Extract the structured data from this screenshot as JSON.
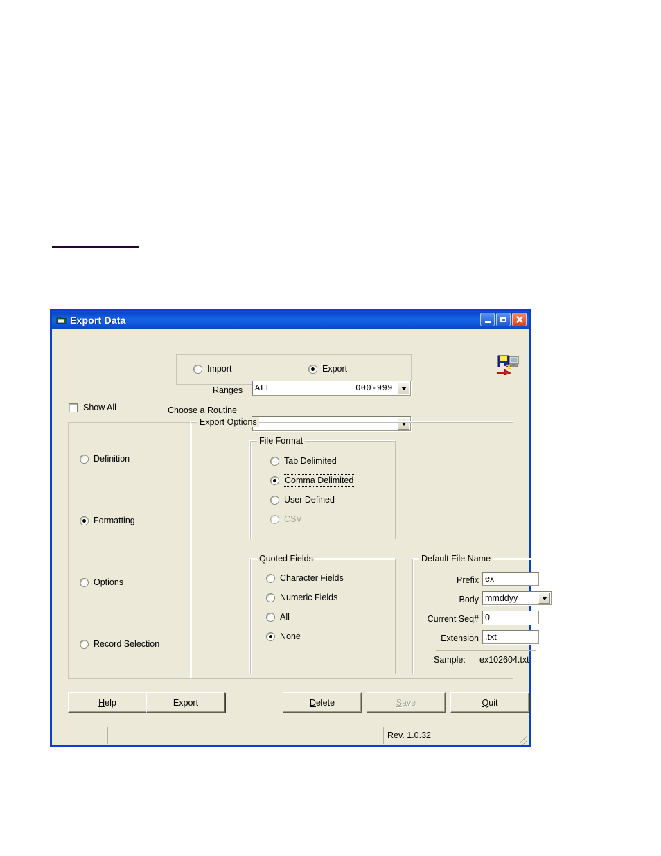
{
  "window": {
    "title": "Export Data",
    "icon": "app-window-icon",
    "buttons": {
      "minimize": "_",
      "maximize": "□",
      "close": "✕"
    }
  },
  "header_icon": "export-to-disk-icon",
  "mode": {
    "options": [
      {
        "label": "Import",
        "selected": false
      },
      {
        "label": "Export",
        "selected": true
      }
    ]
  },
  "ranges": {
    "label": "Ranges",
    "value_name": "ALL",
    "value_range": "000-999"
  },
  "routine": {
    "label": "Choose a Routine",
    "value": ""
  },
  "show_all": {
    "label": "Show All",
    "checked": false
  },
  "sections": {
    "items": [
      {
        "label": "Definition",
        "selected": false
      },
      {
        "label": "Formatting",
        "selected": true
      },
      {
        "label": "Options",
        "selected": false
      },
      {
        "label": "Record Selection",
        "selected": false
      }
    ]
  },
  "export_options": {
    "title": "Export Options",
    "file_format": {
      "title": "File Format",
      "options": [
        {
          "label": "Tab Delimited",
          "selected": false,
          "disabled": false,
          "focused": false
        },
        {
          "label": "Comma Delimited",
          "selected": true,
          "disabled": false,
          "focused": true
        },
        {
          "label": "User Defined",
          "selected": false,
          "disabled": false,
          "focused": false
        },
        {
          "label": "CSV",
          "selected": false,
          "disabled": true,
          "focused": false
        }
      ]
    },
    "quoted_fields": {
      "title": "Quoted Fields",
      "options": [
        {
          "label": "Character Fields",
          "selected": false
        },
        {
          "label": "Numeric Fields",
          "selected": false
        },
        {
          "label": "All",
          "selected": false
        },
        {
          "label": "None",
          "selected": true
        }
      ]
    },
    "default_file_name": {
      "title": "Default File Name",
      "prefix_label": "Prefix",
      "prefix_value": "ex",
      "body_label": "Body",
      "body_value": "mmddyy",
      "seq_label": "Current Seq#",
      "seq_value": "0",
      "extension_label": "Extension",
      "extension_value": ".txt",
      "sample_label": "Sample:",
      "sample_value": "ex102604.txt"
    }
  },
  "footer": {
    "help": {
      "mnemonic": "H",
      "rest": "elp",
      "disabled": false
    },
    "export": {
      "mnemonic": "",
      "rest": "Export",
      "disabled": false
    },
    "delete": {
      "mnemonic": "D",
      "rest": "elete",
      "disabled": false
    },
    "save": {
      "mnemonic": "S",
      "rest": "ave",
      "disabled": true
    },
    "quit": {
      "mnemonic": "Q",
      "rest": "uit",
      "disabled": false
    }
  },
  "status": {
    "pane1": "",
    "pane2": "",
    "revision": "Rev. 1.0.32"
  }
}
